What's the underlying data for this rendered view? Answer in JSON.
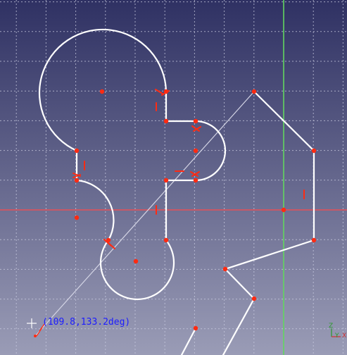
{
  "app": {
    "view": "FreeCAD Sketcher 3D view",
    "background": {
      "top": "#2f3163",
      "bottom": "#9a9cb6"
    },
    "grid_color": "#c9cbe0",
    "x_axis_color": "#ff4a4a",
    "y_axis_color": "#62d65f",
    "geometry_color": "#ffffff",
    "constraint_color": "#ff2b12",
    "construction_line_color": "#d5d6e6"
  },
  "cursor": {
    "readout": "(109.8,133.2deg)",
    "readout_color": "#1c1cff",
    "icon": "crosshair-cursor-icon"
  },
  "axis_indicator": {
    "labels": {
      "z": "Z",
      "y": "Y",
      "x": "X"
    },
    "colors": {
      "z": "#2a9a2a",
      "y": "#2a9a2a",
      "x": "#d03030"
    }
  }
}
